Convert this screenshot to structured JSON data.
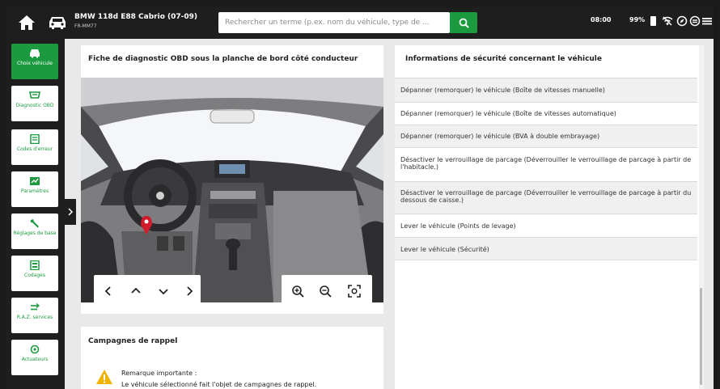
{
  "header": {
    "vehicle_title": "BMW 118d E88 Cabrio (07-09)",
    "vehicle_plate": "FR-MM77",
    "search_placeholder": "Rechercher un terme (p.ex. nom du véhicule, type de ...",
    "time": "08:00",
    "battery": "99%"
  },
  "sidebar": {
    "items": [
      {
        "label": "Choix véhicule",
        "icon": "car-icon"
      },
      {
        "label": "Diagnostic OBD",
        "icon": "obd-connector-icon"
      },
      {
        "label": "Codes d'erreur",
        "icon": "error-codes-icon"
      },
      {
        "label": "Paramètres",
        "icon": "parameters-icon"
      },
      {
        "label": "Réglages de base",
        "icon": "wrench-icon"
      },
      {
        "label": "Codages",
        "icon": "coding-icon"
      },
      {
        "label": "R.A.Z. services",
        "icon": "service-reset-icon"
      },
      {
        "label": "Actuateurs",
        "icon": "actuators-icon"
      }
    ]
  },
  "obd": {
    "title": "Fiche de diagnostic OBD sous la planche de bord côté conducteur"
  },
  "recall": {
    "title": "Campagnes de rappel",
    "note_head": "Remarque importante :",
    "note_text": "Le véhicule sélectionné fait l'objet de campagnes de rappel."
  },
  "safety": {
    "title": "Informations de sécurité concernant le véhicule",
    "items": [
      "Dépanner (remorquer) le véhicule (Boîte de vitesses manuelle)",
      "Dépanner (remorquer) le véhicule (Boîte de vitesses automatique)",
      "Dépanner (remorquer) le véhicule (BVA à double embrayage)",
      "Désactiver le verrouillage de parcage (Déverrouiller le verrouillage de parcage à partir de l'habitacle.)",
      "Désactiver le verrouillage de parcage (Déverrouiller le verrouillage de parcage à partir du dessous de caisse.)",
      "Lever le véhicule (Points de levage)",
      "Lever le véhicule (Sécurité)"
    ]
  },
  "colors": {
    "accent": "#1b9a3f",
    "topbar": "#1e1e1e",
    "background": "#e9e9e9",
    "warning": "#f0b400",
    "marker": "#d21b2a"
  }
}
